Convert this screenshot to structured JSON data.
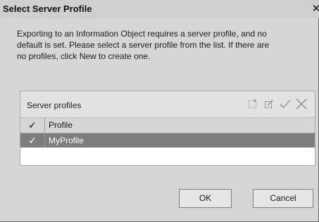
{
  "window": {
    "title": "Select Server Profile",
    "close_glyph": "✕"
  },
  "message": {
    "line1": "Exporting to an Information Object requires a server profile, and no",
    "line2": "default is set.  Please select a server profile from the list.  If there are",
    "line3": "no profiles, click New to create one."
  },
  "profiles_panel": {
    "title": "Server profiles",
    "toolbar_icons": [
      "new-icon",
      "edit-icon",
      "check-icon",
      "delete-icon"
    ],
    "columns": {
      "check_glyph": "✓",
      "profile": "Profile"
    },
    "rows": [
      {
        "checked_glyph": "✓",
        "name": "MyProfile",
        "selected": true
      }
    ]
  },
  "buttons": {
    "ok": "OK",
    "cancel": "Cancel"
  },
  "colors": {
    "dialog_bg": "#d6d6d6",
    "selected_row": "#7d7d7d"
  }
}
